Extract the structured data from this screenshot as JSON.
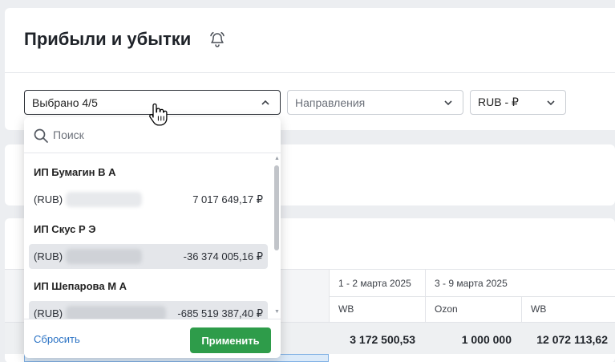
{
  "page": {
    "title": "Прибыли и убытки"
  },
  "filters": {
    "entities": {
      "value": "Выбрано 4/5"
    },
    "directions": {
      "placeholder": "Направления"
    },
    "currency": {
      "value": "RUB - ₽"
    }
  },
  "dropdown": {
    "search": {
      "placeholder": "Поиск"
    },
    "groups": [
      {
        "name": "ИП Бумагин В А",
        "account": {
          "currency": "(RUB)",
          "amount": "7 017 649,17 ₽",
          "selected": false
        }
      },
      {
        "name": "ИП Скус Р Э",
        "account": {
          "currency": "(RUB)",
          "amount": "-36 374 005,16 ₽",
          "selected": true
        }
      },
      {
        "name": "ИП Шепарова М А",
        "account": {
          "currency": "(RUB)",
          "amount": "-685 519 387,40 ₽",
          "selected": true
        }
      }
    ],
    "reset_label": "Сбросить",
    "apply_label": "Применить"
  },
  "table": {
    "periods": [
      "1 - 2 марта 2025",
      "3 - 9 марта 2025"
    ],
    "subheaders": [
      "WB",
      "Ozon",
      "WB"
    ],
    "totals": [
      "3 172 500,53",
      "1 000 000",
      "12 072 113,62"
    ]
  },
  "colors": {
    "accent": "#2e9c4a",
    "link": "#2a72c4",
    "selected_row": "#e4e6ea"
  }
}
